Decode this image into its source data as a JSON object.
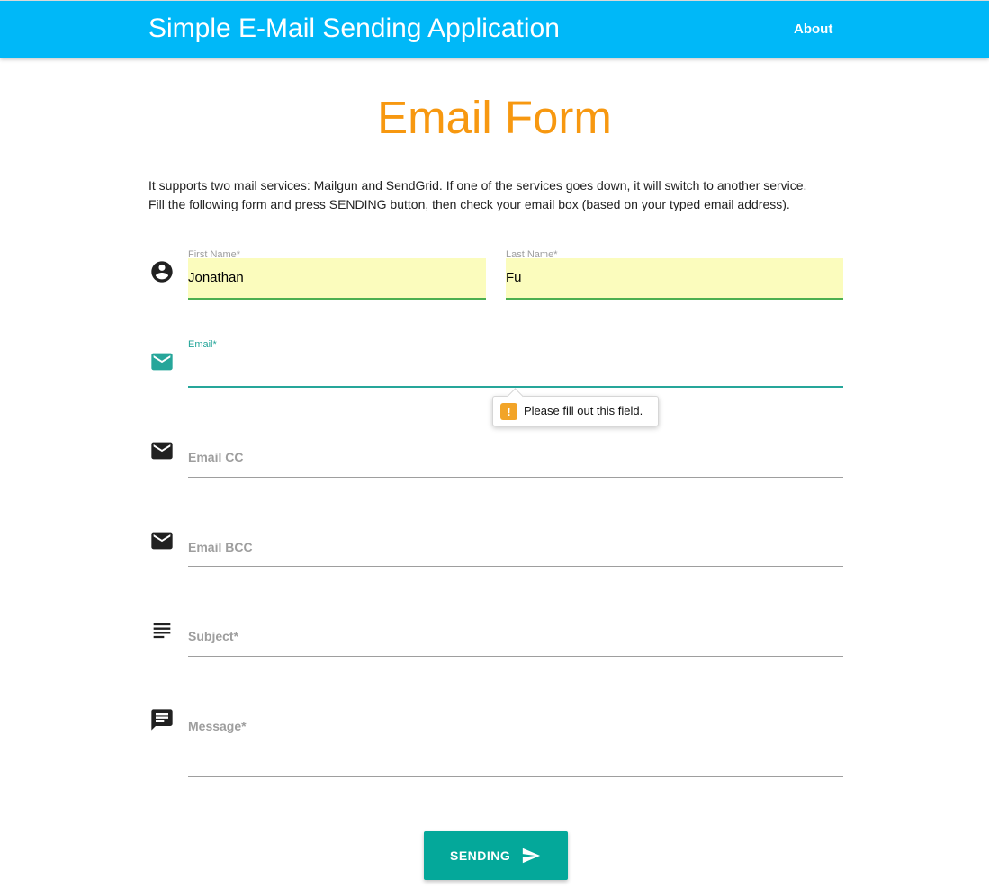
{
  "navbar": {
    "brand": "Simple E-Mail Sending Application",
    "about": "About"
  },
  "page": {
    "title": "Email Form",
    "intro_line1": "It supports two mail services: Mailgun and SendGrid. If one of the services goes down, it will switch to another service.",
    "intro_line2": "Fill the following form and press SENDING button, then check your email box (based on your typed email address)."
  },
  "form": {
    "first_name": {
      "label": "First Name*",
      "value": "Jonathan"
    },
    "last_name": {
      "label": "Last Name*",
      "value": "Fu"
    },
    "email": {
      "label": "Email*",
      "value": ""
    },
    "email_cc": {
      "placeholder": "Email CC"
    },
    "email_bcc": {
      "placeholder": "Email BCC"
    },
    "subject": {
      "placeholder": "Subject*"
    },
    "message": {
      "placeholder": "Message*"
    },
    "validation_tooltip": "Please fill out this field.",
    "submit_label": "SENDING"
  },
  "icons": {
    "name": "account-circle-icon",
    "email": "email-icon",
    "email_cc": "email-icon",
    "email_bcc": "email-icon",
    "subject": "subject-icon",
    "message": "message-icon",
    "submit": "send-icon",
    "warning": "warning-icon"
  },
  "colors": {
    "navbar": "#00b8f8",
    "title": "#f79810",
    "accent": "#04a89a",
    "focused_underline": "#26a69a",
    "valid_underline": "#4caf50",
    "autofill_bg": "#fbfcbd",
    "warning": "#f2a428"
  }
}
